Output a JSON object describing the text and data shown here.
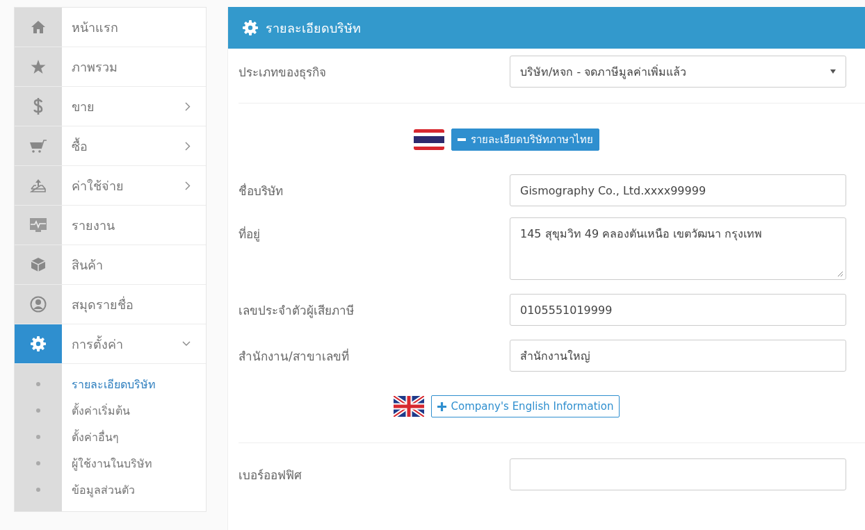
{
  "sidebar": {
    "items": [
      {
        "label": "หน้าแรก",
        "kind": "link",
        "selected": false
      },
      {
        "label": "ภาพรวม",
        "kind": "link",
        "selected": false
      },
      {
        "label": "ขาย",
        "kind": "group",
        "expanded": false,
        "selected": false
      },
      {
        "label": "ซื้อ",
        "kind": "group",
        "expanded": false,
        "selected": false
      },
      {
        "label": "ค่าใช้จ่าย",
        "kind": "group",
        "expanded": false,
        "selected": false
      },
      {
        "label": "รายงาน",
        "kind": "link",
        "selected": false
      },
      {
        "label": "สินค้า",
        "kind": "link",
        "selected": false
      },
      {
        "label": "สมุดรายชื่อ",
        "kind": "link",
        "selected": false
      },
      {
        "label": "การตั้งค่า",
        "kind": "group",
        "expanded": true,
        "selected": true,
        "children": [
          {
            "label": "รายละเอียดบริษัท",
            "selected": true
          },
          {
            "label": "ตั้งค่าเริ่มต้น",
            "selected": false
          },
          {
            "label": "ตั้งค่าอื่นๆ",
            "selected": false
          },
          {
            "label": "ผู้ใช้งานในบริษัท",
            "selected": false
          },
          {
            "label": "ข้อมูลส่วนตัว",
            "selected": false
          }
        ]
      }
    ]
  },
  "panel": {
    "title": "รายละเอียดบริษัท",
    "rows": [
      {
        "kind": "select",
        "label": "ประเภทของธุรกิจ",
        "value": "บริษัท/หจก - จดภาษีมูลค่าเพิ่มแล้ว"
      },
      {
        "kind": "divider"
      },
      {
        "kind": "section",
        "flag": {
          "kind": "thai"
        },
        "label": "รายละเอียดบริษัทภาษาไทย",
        "expanded": true
      },
      {
        "kind": "input",
        "label": "ชื่อบริษัท",
        "value": "Gismography Co., Ltd.xxxx99999"
      },
      {
        "kind": "textarea",
        "label": "ที่อยู่",
        "value": "145 สุขุมวิท 49 คลองตันเหนือ เขตวัฒนา กรุงเทพ"
      },
      {
        "kind": "input",
        "label": "เลขประจำตัวผู้เสียภาษี",
        "value": "0105551019999"
      },
      {
        "kind": "input",
        "label": "สำนักงาน/สาขาเลขที่",
        "value": "สำนักงานใหญ่"
      },
      {
        "kind": "section",
        "flag": {
          "kind": "uk"
        },
        "label": "Company's English Information",
        "expanded": false
      },
      {
        "kind": "divider"
      },
      {
        "kind": "input",
        "label": "เบอร์ออฟฟิศ"
      }
    ]
  }
}
